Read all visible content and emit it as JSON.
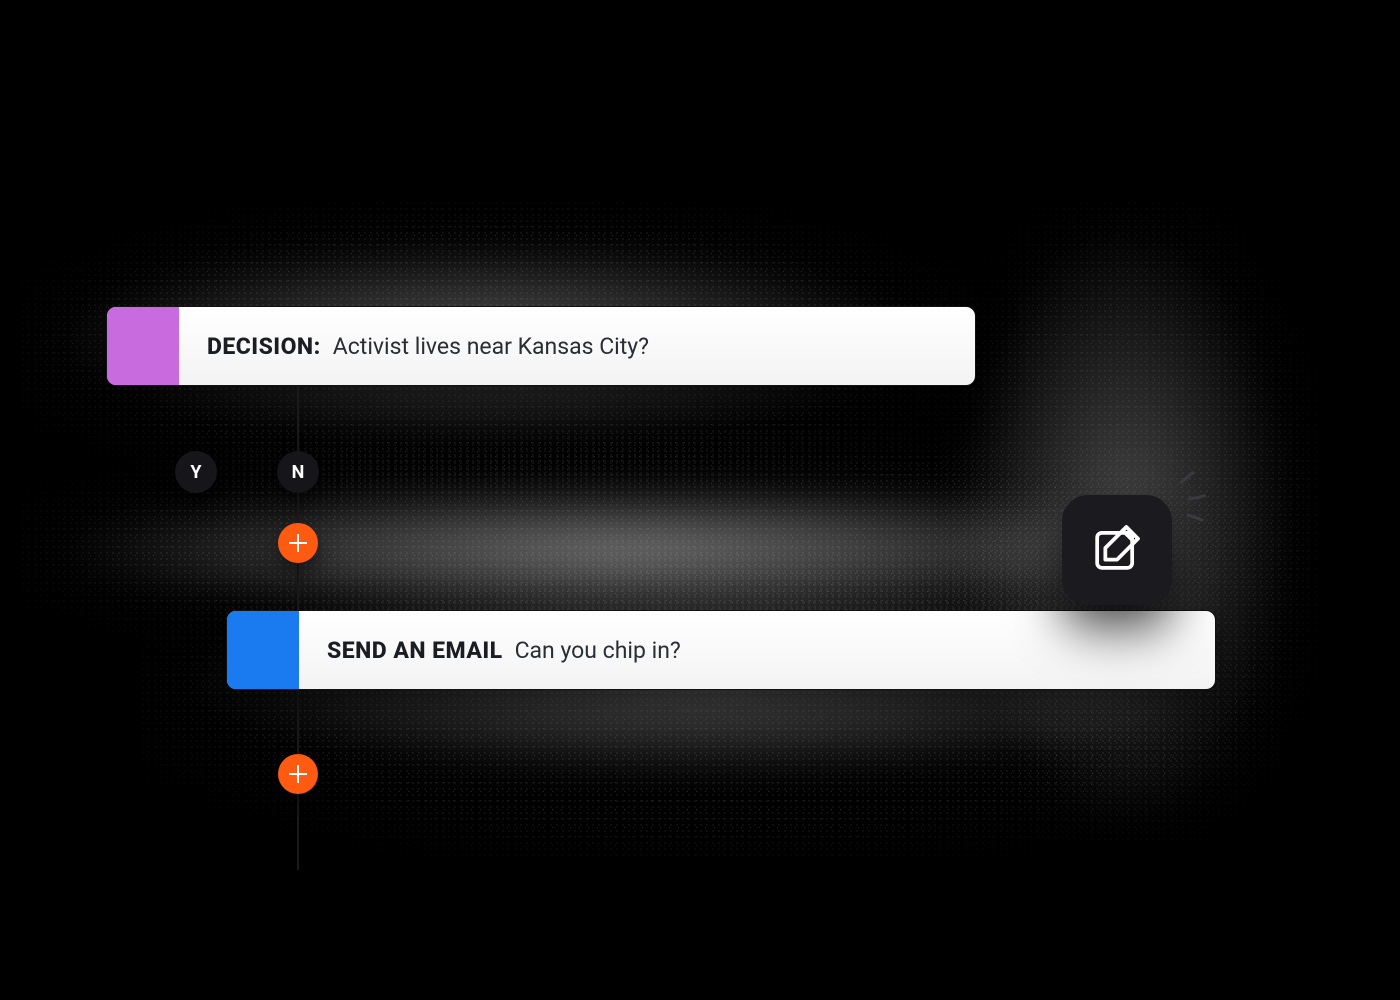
{
  "colors": {
    "decision_swatch": "#c86bde",
    "email_swatch": "#1a7af0",
    "add_button": "#ff5a12",
    "chip_bg": "#16161a"
  },
  "flow": {
    "decision": {
      "label": "DECISION:",
      "text": "Activist lives near Kansas City?"
    },
    "branches": {
      "yes": "Y",
      "no": "N"
    },
    "email": {
      "label": "SEND AN EMAIL",
      "text": "Can you chip in?"
    }
  },
  "icons": {
    "add": "plus-icon",
    "edit": "edit-pencil-icon"
  }
}
